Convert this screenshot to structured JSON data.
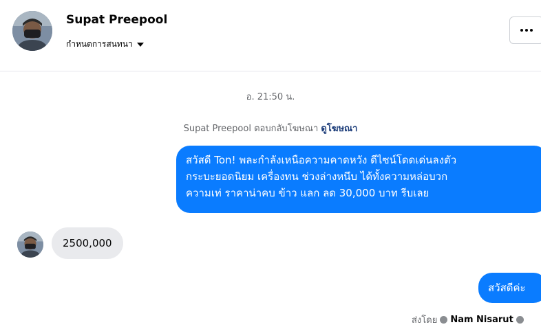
{
  "header": {
    "name": "Supat Preepool",
    "subline": "กำหนดการสนทนา"
  },
  "thread": {
    "timestamp": "อ. 21:50 น.",
    "ad_reply_text": "Supat Preepool ตอบกลับโฆษณา",
    "ad_link": "ดูโฆษณา",
    "outgoing_message_lines": [
      "สวัสดี Ton! พละกำลังเหนือความคาดหวัง ดีไซน์โดดเด่นลงตัว",
      "กระบะยอดนิยม เครื่องทน ช่วงล่างหนึบ ได้ทั้งความหล่อบวก",
      "ความเท่ ราคาน่าคบ ข้าว แลก ลด 30,000 บาท รีบเลย"
    ],
    "incoming_message": "2500,000",
    "outgoing_reply": "สวัสดีค่ะ",
    "sent_by_label": "ส่งโดย",
    "sent_by_name": "Nam Nisarut"
  },
  "colors": {
    "outgoing_bubble": "#0a7cff",
    "incoming_bubble": "#e9eaed",
    "ad_link": "#1c3d7a"
  }
}
